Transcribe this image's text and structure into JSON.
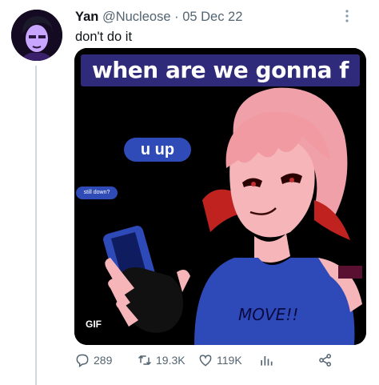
{
  "tweet": {
    "author_name": "Yan",
    "author_handle": "@Nucleose",
    "separator": "·",
    "date": "05 Dec 22",
    "text": "don't do it"
  },
  "media": {
    "caption": "when are we gonna f",
    "bubble_primary": "u up",
    "bubble_secondary": "still down?",
    "shirt_text": "MOVE!!",
    "badge": "GIF"
  },
  "actions": {
    "replies": "289",
    "retweets": "19.3K",
    "likes": "119K"
  },
  "icons": [
    "more-icon",
    "reply-icon",
    "retweet-icon",
    "like-icon",
    "views-icon",
    "share-icon"
  ]
}
